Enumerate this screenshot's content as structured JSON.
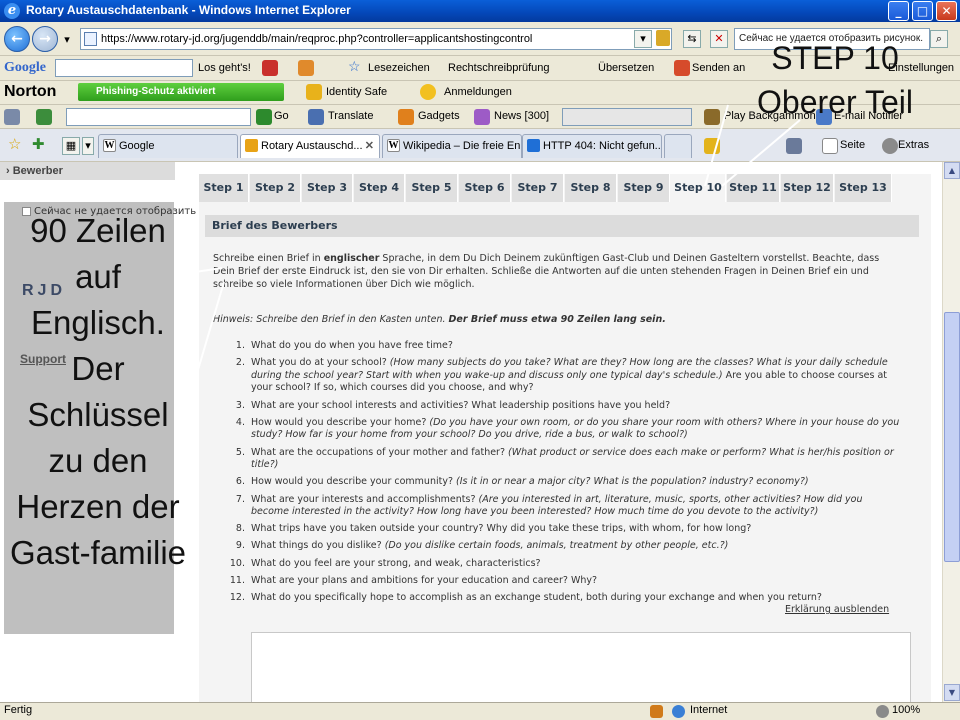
{
  "window": {
    "title": "Rotary Austauschdatenbank - Windows Internet Explorer",
    "minimize": "_",
    "maximize": "□",
    "close": "✕"
  },
  "address_bar": {
    "url": "https://www.rotary-jd.org/jugenddb/main/reqproc.php?controller=applicantshostingcontrol",
    "search_text": "Сейчас не удается отобразить рисунок."
  },
  "google_toolbar": {
    "logo": "Google",
    "button": "Los geht's!",
    "items": [
      "Lesezeichen",
      "Rechtschreibprüfung",
      "Übersetzen",
      "Senden an",
      "Einstellungen"
    ]
  },
  "norton_toolbar": {
    "logo": "Norton",
    "phishing": "Phishing-Schutz aktiviert",
    "identity": "Identity Safe",
    "logins": "Anmeldungen"
  },
  "links_toolbar": {
    "go": "Go",
    "translate": "Translate",
    "gadgets": "Gadgets",
    "news": "News [300]",
    "play": "Play Backgammon",
    "mail": "E-mail Notifier"
  },
  "tabs": [
    {
      "label": "Google",
      "favicon_color": "#ffffff"
    },
    {
      "label": "Rotary Austauschd...",
      "favicon_color": "#e8a317",
      "active": true
    },
    {
      "label": "Wikipedia – Die freie En...",
      "favicon_color": "#ffffff"
    },
    {
      "label": "HTTP 404: Nicht gefun...",
      "favicon_color": "#1f6fd6"
    }
  ],
  "command_bar": {
    "page": "Seite",
    "extras": "Extras"
  },
  "left_nav": {
    "bewerber": "Bewerber",
    "notice": "Сейчас не удается отобразить рисунок.",
    "logo": "RJD",
    "support": "Support"
  },
  "steps": [
    "Step 1",
    "Step 2",
    "Step 3",
    "Step 4",
    "Step 5",
    "Step 6",
    "Step 7",
    "Step 8",
    "Step 9",
    "Step 10",
    "Step 11",
    "Step 12",
    "Step 13"
  ],
  "active_step": "Step 10",
  "section_title": "Brief des Bewerbers",
  "intro": {
    "p1": "Schreibe einen Brief in ",
    "bold": "englischer",
    "p2": " Sprache, in dem Du Dich Deinem zukünftigen Gast-Club und Deinen Gasteltern vorstellst. Beachte, dass Dein Brief der erste Eindruck ist, den sie von Dir erhalten. Schließe die Antworten auf die unten stehenden Fragen in Deinen Brief ein und schreibe so viele Informationen über Dich wie möglich."
  },
  "hint": {
    "p1": "Hinweis: Schreibe den Brief in den Kasten unten. ",
    "bold": "Der Brief muss etwa 90 Zeilen lang sein."
  },
  "questions": [
    {
      "num": "1.",
      "q": "What do you do when you have free time?",
      "sub": ""
    },
    {
      "num": "2.",
      "q": "What you do at your school? ",
      "sub": "(How many subjects do you take? What are they? How long are the classes? What is your daily schedule during the school year? Start with when you wake-up and discuss only one typical day's schedule.)",
      "q2": " Are you able to choose courses at your school? If so, which courses did you choose, and why?"
    },
    {
      "num": "3.",
      "q": "What are your school interests and activities? What leadership positions have you held?",
      "sub": ""
    },
    {
      "num": "4.",
      "q": "How would you describe your home? ",
      "sub": "(Do you have your own room, or do you share your room with others? Where in your house do you study? How far is your home from your school? Do you drive, ride a bus, or walk to school?)"
    },
    {
      "num": "5.",
      "q": "What are the occupations of your mother and father? ",
      "sub": "(What product or service does each make or perform? What is her/his position or title?)"
    },
    {
      "num": "6.",
      "q": "How would you describe your community? ",
      "sub": "(Is it in or near a major city? What is the population? industry? economy?)"
    },
    {
      "num": "7.",
      "q": "What are your interests and accomplishments? ",
      "sub": "(Are you interested in art, literature, music, sports, other activities? How did you become interested in the activity? How long have you been interested? How much time do you devote to the activity?)"
    },
    {
      "num": "8.",
      "q": "What trips have you taken outside your country? Why did you take these trips, with whom, for how long?",
      "sub": ""
    },
    {
      "num": "9.",
      "q": "What things do you dislike? ",
      "sub": "(Do you dislike certain foods, animals, treatment by other people, etc.?)"
    },
    {
      "num": "10.",
      "q": "What do you feel are your strong, and weak, characteristics?",
      "sub": ""
    },
    {
      "num": "11.",
      "q": "What are your plans and ambitions for your education and career? Why?",
      "sub": ""
    },
    {
      "num": "12.",
      "q": "What do you specifically hope to accomplish as an exchange student, both during your exchange and when you return?",
      "sub": ""
    }
  ],
  "hide_link": "Erklärung ausblenden",
  "status": {
    "left": "Fertig",
    "zone": "Internet",
    "zoom": "100%"
  },
  "annotations": {
    "top_right": "STEP 10 Oberer Teil",
    "left": "90 Zeilen auf Englisch. Der Schlüssel zu den Herzen der Gast-familie"
  }
}
